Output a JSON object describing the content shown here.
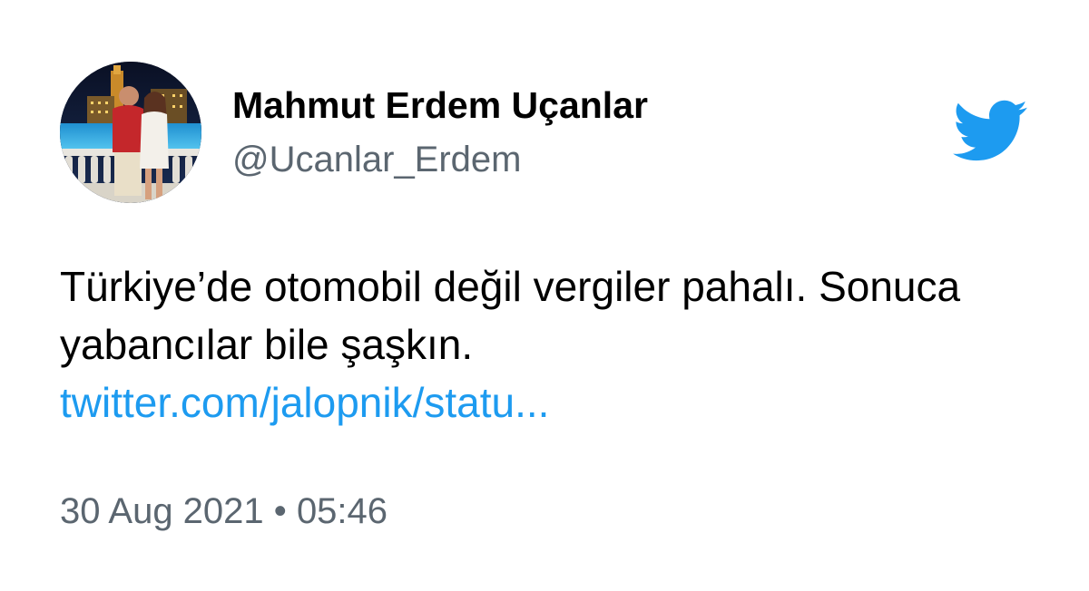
{
  "author": {
    "name": "Mahmut Erdem Uçanlar",
    "handle": "@Ucanlar_Erdem"
  },
  "tweet": {
    "line1": "Türkiye’de otomobil değil vergiler pahalı. Sonuca",
    "line2": "yabancılar bile şaşkın.",
    "link": "twitter.com/jalopnik/statu..."
  },
  "meta": {
    "date": "30 Aug 2021",
    "separator": "•",
    "time": "05:46"
  },
  "colors": {
    "brand": "#1d9bf0",
    "secondary_text": "#5b6670"
  },
  "icons": {
    "brand": "twitter-bird-icon",
    "avatar": "user-avatar-photo"
  }
}
